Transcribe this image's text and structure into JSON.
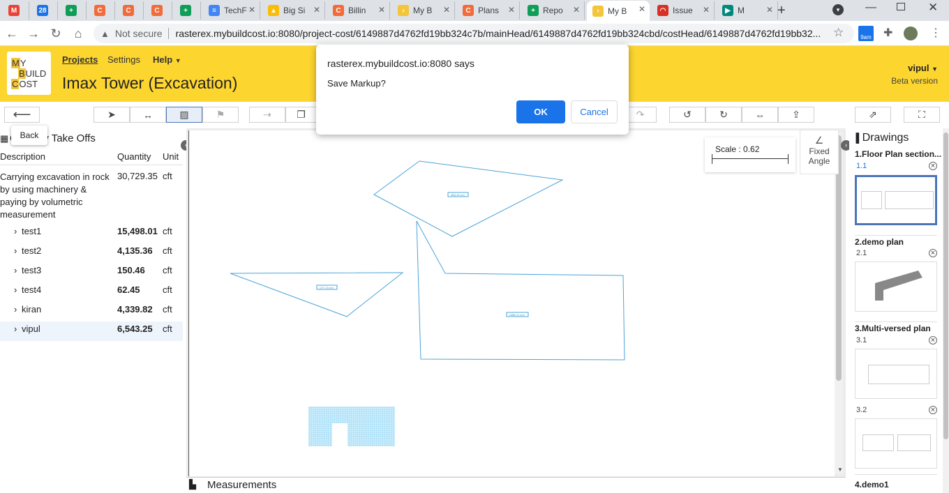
{
  "browser": {
    "tabs": [
      {
        "label": "",
        "icon": "gmail-icon",
        "color": "#ea4335",
        "glyph": "M"
      },
      {
        "label": "",
        "icon": "calendar-icon",
        "color": "#1a73e8",
        "glyph": "28"
      },
      {
        "label": "",
        "icon": "sheets-icon",
        "color": "#0f9d58",
        "glyph": "+"
      },
      {
        "label": "",
        "icon": "c-app-icon",
        "color": "#f26b3a",
        "glyph": "C"
      },
      {
        "label": "",
        "icon": "c-app-icon",
        "color": "#f26b3a",
        "glyph": "C"
      },
      {
        "label": "",
        "icon": "c-app-icon",
        "color": "#f26b3a",
        "glyph": "C"
      },
      {
        "label": "",
        "icon": "sheets-icon",
        "color": "#0f9d58",
        "glyph": "+"
      },
      {
        "label": "TechF",
        "icon": "docs-icon",
        "color": "#4285f4",
        "glyph": "≡"
      },
      {
        "label": "Big Si",
        "icon": "drive-icon",
        "color": "#fbbc04",
        "glyph": "▲"
      },
      {
        "label": "Billin",
        "icon": "c-app-icon",
        "color": "#f26b3a",
        "glyph": "C"
      },
      {
        "label": "My B",
        "icon": "mbc-icon",
        "color": "#f3c53a",
        "glyph": "›"
      },
      {
        "label": "Plans",
        "icon": "c-app-icon",
        "color": "#f26b3a",
        "glyph": "C"
      },
      {
        "label": "Repo",
        "icon": "sheets-icon",
        "color": "#0f9d58",
        "glyph": "+"
      },
      {
        "label": "My B",
        "icon": "mbc-icon",
        "color": "#f3c53a",
        "glyph": "›"
      },
      {
        "label": "Issue",
        "icon": "gauge-icon",
        "color": "#d93025",
        "glyph": "◠"
      },
      {
        "label": "M",
        "icon": "meet-icon",
        "color": "#00897b",
        "glyph": "▶"
      }
    ],
    "address": {
      "security": "Not secure",
      "url": "rasterex.mybuildcost.io:8080/project-cost/6149887d4762fd19bb324c7b/mainHead/6149887d4762fd19bb324cbd/costHead/6149887d4762fd19bb32..."
    },
    "ext_badge": "9am"
  },
  "app": {
    "logo": {
      "line1": "M",
      "line1b": "Y",
      "line2": "B",
      "line2b": "UILD",
      "line3": "C",
      "line3b": "OST"
    },
    "nav": {
      "projects": "Projects",
      "settings": "Settings",
      "help": "Help"
    },
    "title": "Imax Tower (Excavation)",
    "user": "vipul",
    "beta": "Beta version"
  },
  "toolbar": {
    "back_tooltip": "Back"
  },
  "takeoffs": {
    "heading": "Quantity Take Offs",
    "columns": {
      "description": "Description",
      "quantity": "Quantity",
      "unit": "Unit"
    },
    "item": {
      "description": "Carrying excavation in rock by using machinery & paying by volumetric measurement",
      "quantity": "30,729.35",
      "unit": "cft"
    },
    "rows": [
      {
        "name": "test1",
        "quantity": "15,498.01",
        "unit": "cft"
      },
      {
        "name": "test2",
        "quantity": "4,135.36",
        "unit": "cft"
      },
      {
        "name": "test3",
        "quantity": "150.46",
        "unit": "cft"
      },
      {
        "name": "test4",
        "quantity": "62.45",
        "unit": "cft"
      },
      {
        "name": "kiran",
        "quantity": "4,339.82",
        "unit": "cft"
      },
      {
        "name": "vipul",
        "quantity": "6,543.25",
        "unit": "cft"
      }
    ]
  },
  "canvas": {
    "scale_label": "Scale : 0.62",
    "fixed_angle": "Fixed Angle",
    "area_labels": [
      "4852.25 mm²",
      "1277.73 mm²",
      "18880.31 mm²"
    ],
    "measurements_label": "Measurements"
  },
  "drawings": {
    "heading": "Drawings",
    "groups": [
      {
        "title": "1.Floor Plan section...",
        "pages": [
          "1.1"
        ]
      },
      {
        "title": "2.demo plan",
        "pages": [
          "2.1"
        ]
      },
      {
        "title": "3.Multi-versed plan",
        "pages": [
          "3.1",
          "3.2"
        ]
      },
      {
        "title": "4.demo1",
        "pages": []
      }
    ]
  },
  "dialog": {
    "title": "rasterex.mybuildcost.io:8080 says",
    "message": "Save Markup?",
    "ok": "OK",
    "cancel": "Cancel"
  },
  "colors": {
    "brand": "#fdd52f",
    "markup": "#4aa3d8",
    "primary": "#1a73e8"
  }
}
